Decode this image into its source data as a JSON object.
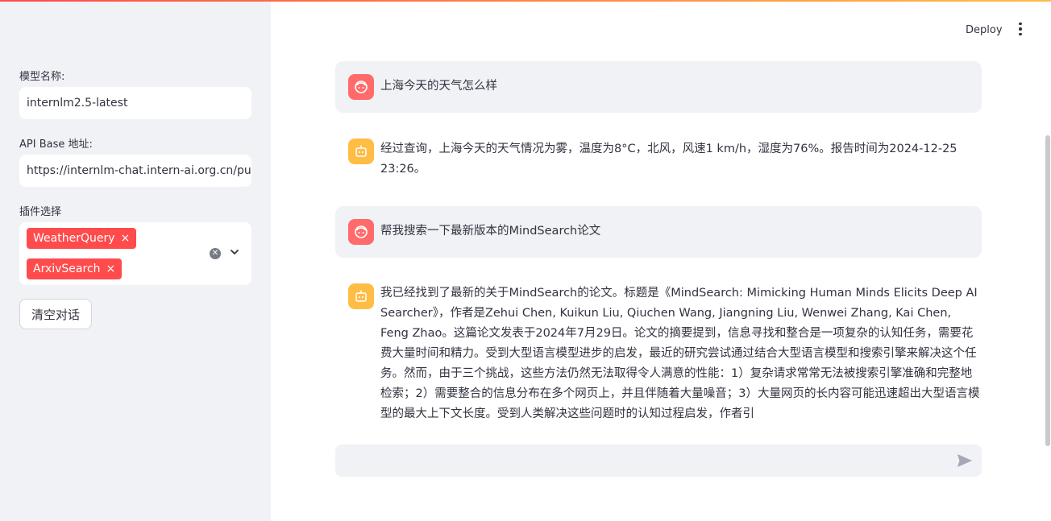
{
  "header": {
    "deploy_label": "Deploy",
    "menu_icon": "kebab-menu-icon"
  },
  "sidebar": {
    "model_label": "模型名称:",
    "model_value": "internlm2.5-latest",
    "api_label": "API Base 地址:",
    "api_value": "https://internlm-chat.intern-ai.org.cn/pu",
    "plugin_label": "插件选择",
    "plugins": [
      {
        "name": "WeatherQuery",
        "remove": "×"
      },
      {
        "name": "ArxivSearch",
        "remove": "×"
      }
    ],
    "clear_button": "清空对话"
  },
  "messages": [
    {
      "role": "user",
      "text": "上海今天的天气怎么样"
    },
    {
      "role": "assistant",
      "text": "经过查询，上海今天的天气情况为雾，温度为8°C，北风，风速1 km/h，湿度为76%。报告时间为2024-12-25 23:26。"
    },
    {
      "role": "user",
      "text": "帮我搜索一下最新版本的MindSearch论文"
    },
    {
      "role": "assistant",
      "text": "我已经找到了最新的关于MindSearch的论文。标题是《MindSearch: Mimicking Human Minds Elicits Deep AI Searcher》，作者是Zehui Chen, Kuikun Liu, Qiuchen Wang, Jiangning Liu, Wenwei Zhang, Kai Chen, Feng Zhao。这篇论文发表于2024年7月29日。论文的摘要提到，信息寻找和整合是一项复杂的认知任务，需要花费大量时间和精力。受到大型语言模型进步的启发，最近的研究尝试通过结合大型语言模型和搜索引擎来解决这个任务。然而，由于三个挑战，这些方法仍然无法取得令人满意的性能：1）复杂请求常常无法被搜索引擎准确和完整地检索；2）需要整合的信息分布在多个网页上，并且伴随着大量噪音；3）大量网页的长内容可能迅速超出大型语言模型的最大上下文长度。受到人类解决这些问题时的认知过程启发，作者引"
    }
  ],
  "chat_input": {
    "value": "",
    "placeholder": ""
  },
  "colors": {
    "accent": "#ff4b4b",
    "user_avatar": "#ff6b6b",
    "bot_avatar": "#ffbd45",
    "sidebar_bg": "#f0f2f6"
  }
}
